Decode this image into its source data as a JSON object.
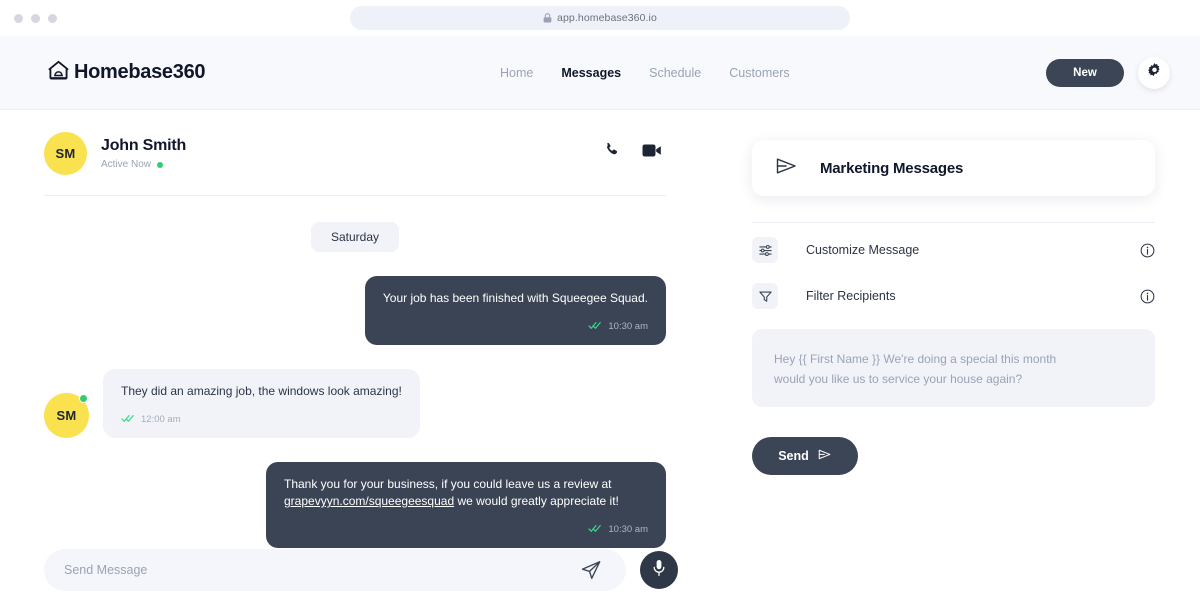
{
  "browser": {
    "url": "app.homebase360.io",
    "lock_icon": "lock-icon",
    "dots": [
      "window-dot",
      "window-dot",
      "window-dot"
    ]
  },
  "header": {
    "brand_name": "Homebase360",
    "brand_icon": "house-icon",
    "nav": [
      {
        "label": "Home",
        "active": false
      },
      {
        "label": "Messages",
        "active": true
      },
      {
        "label": "Schedule",
        "active": false
      },
      {
        "label": "Customers",
        "active": false
      }
    ],
    "new_button": "New",
    "gear_icon": "gear-icon"
  },
  "conversation": {
    "avatar_initials": "SM",
    "contact_name": "John Smith",
    "status": "Active Now",
    "status_color": "#32cd6e",
    "phone_icon": "phone-icon",
    "video_icon": "video-camera-icon",
    "date_separator": "Saturday",
    "messages": [
      {
        "direction": "out",
        "text": "Your job has been finished with Squeegee Squad.",
        "time": "10:30 am",
        "read_icon": "double-check-icon"
      },
      {
        "direction": "in",
        "avatar_initials": "SM",
        "text": "They did an amazing job, the windows look amazing!",
        "time": "12:00 am",
        "read_icon": "double-check-icon"
      },
      {
        "direction": "out",
        "text_before": "Thank you for your business, if you could leave us a review at ",
        "link": "grapevyyn.com/squeegeesquad",
        "text_after": " we would greatly appreciate it!",
        "time": "10:30 am",
        "read_icon": "double-check-icon"
      }
    ],
    "composer": {
      "placeholder": "Send Message",
      "value": "",
      "send_icon": "paper-plane-icon",
      "mic_icon": "microphone-icon"
    }
  },
  "marketing_panel": {
    "title": "Marketing Messages",
    "title_icon": "send-triangle-icon",
    "options": [
      {
        "label": "Customize Message",
        "icon": "sliders-icon",
        "info_icon": "info-icon"
      },
      {
        "label": "Filter Recipients",
        "icon": "funnel-icon",
        "info_icon": "info-icon"
      }
    ],
    "preview_line_1": "Hey {{ First Name }} We're doing a special this month",
    "preview_line_2": "would you like us to service your house again?",
    "send_button": "Send",
    "send_button_icon": "send-triangle-icon"
  },
  "colors": {
    "accent_dark": "#3b4556",
    "avatar_yellow": "#f9e14f",
    "status_green": "#32cd6e",
    "bubble_out": "#3a4454",
    "bubble_in": "#f1f3f9",
    "header_bg": "#f8f9fc"
  }
}
